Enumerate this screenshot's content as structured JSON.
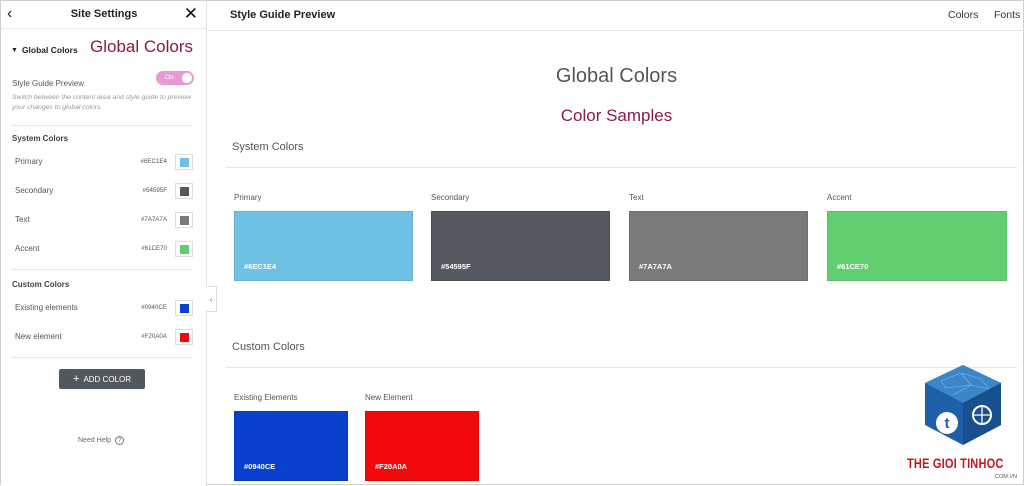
{
  "sidebar": {
    "title": "Site Settings",
    "global_colors_label": "Global Colors",
    "global_colors_annotation": "Global Colors",
    "style_guide_preview_label": "Style Guide Preview",
    "toggle_text": "On",
    "hint": "Switch between the content area and style guide to preview your changes to global colors.",
    "system_colors_title": "System Colors",
    "system_colors": [
      {
        "name": "Primary",
        "hex": "#6EC1E4",
        "color": "#6EC1E4"
      },
      {
        "name": "Secondary",
        "hex": "#54595F",
        "color": "#54595F"
      },
      {
        "name": "Text",
        "hex": "#7A7A7A",
        "color": "#7A7A7A"
      },
      {
        "name": "Accent",
        "hex": "#61CE70",
        "color": "#61CE70"
      }
    ],
    "custom_colors_title": "Custom Colors",
    "custom_colors": [
      {
        "name": "Existing elements",
        "hex": "#0940CE",
        "color": "#0940CE"
      },
      {
        "name": "New element",
        "hex": "#F20A0A",
        "color": "#F20A0A"
      }
    ],
    "add_color_label": "ADD COLOR",
    "need_help_label": "Need Help",
    "help_icon_text": "?"
  },
  "main": {
    "header_title": "Style Guide Preview",
    "tabs": [
      "Colors",
      "Fonts"
    ],
    "page_title": "Global Colors",
    "samples_annotation": "Color Samples",
    "system_colors_title": "System Colors",
    "system_colors": [
      {
        "name": "Primary",
        "hex": "#6EC1E4",
        "color": "#6EC1E4"
      },
      {
        "name": "Secondary",
        "hex": "#54595F",
        "color": "#54595F"
      },
      {
        "name": "Text",
        "hex": "#7A7A7A",
        "color": "#7A7A7A"
      },
      {
        "name": "Accent",
        "hex": "#61CE70",
        "color": "#61CE70"
      }
    ],
    "custom_colors_title": "Custom Colors",
    "custom_colors": [
      {
        "name": "Existing Elements",
        "hex": "#0940CE",
        "color": "#0940CE"
      },
      {
        "name": "New Element",
        "hex": "#F20A0A",
        "color": "#F20A0A"
      }
    ]
  },
  "watermark": {
    "brand": "THE GIOI TINHOC",
    "domain": ".COM.VN",
    "icon_letter": "t"
  },
  "theme": {
    "annotation_color": "#8b1a4d",
    "toggle_color": "#e999d6",
    "button_color": "#525861",
    "logo_blue": "#1d5fa8"
  }
}
